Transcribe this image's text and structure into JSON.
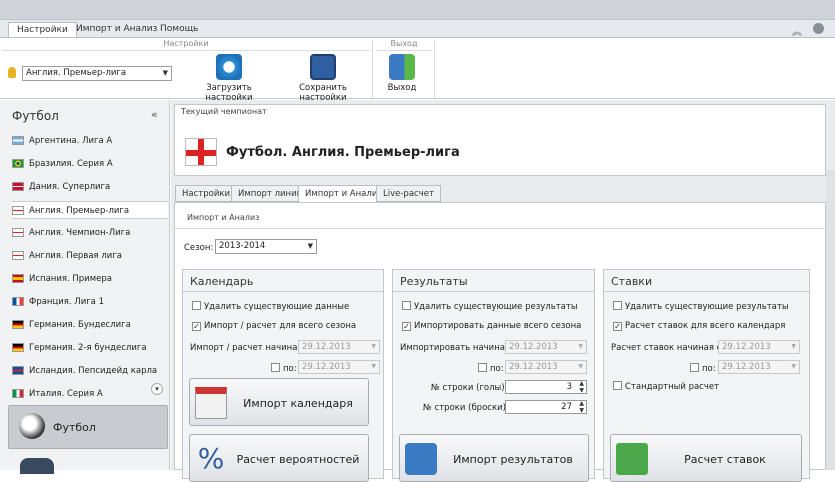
{
  "ribbon": {
    "tabs": [
      "Настройки",
      "Импорт и Анализ",
      "Помощь"
    ],
    "group_settings": "Настройки",
    "group_exit": "Выход",
    "league_combo": "Англия. Премьер-лига",
    "load_label": "Загрузить настройки",
    "save_label": "Сохранить настройки",
    "exit_label": "Выход"
  },
  "sidebar": {
    "title": "Футбол",
    "collapse": "«",
    "items": [
      {
        "label": "Аргентина. Лига А"
      },
      {
        "label": "Бразилия. Серия А"
      },
      {
        "label": "Дания. Суперлига"
      },
      {
        "label": "Англия. Премьер-лига"
      },
      {
        "label": "Англия. Чемпион-Лига"
      },
      {
        "label": "Англия. Первая лига"
      },
      {
        "label": "Испания. Примера"
      },
      {
        "label": "Франция. Лига 1"
      },
      {
        "label": "Германия. Бундеслига"
      },
      {
        "label": "Германия. 2-я бундеслига"
      },
      {
        "label": "Исландия. Пепсидейд карла"
      },
      {
        "label": "Италия. Серия А"
      }
    ],
    "big_button": "Футбол"
  },
  "champ": {
    "box_label": "Текущий чемпионат",
    "title": "Футбол. Англия. Премьер-лига"
  },
  "tabs": [
    "Настройки",
    "Импорт линий",
    "Импорт и Анализ",
    "Live-расчет"
  ],
  "content": {
    "box_label": "Импорт и Анализ",
    "season_label": "Сезон:",
    "season_value": "2013-2014"
  },
  "calendar": {
    "title": "Календарь",
    "delete_label": "Удалить существующие данные",
    "import_all_label": "Импорт / расчет для всего сезона",
    "from_label": "Импорт / расчет начиная с:",
    "from_date": "29.12.2013",
    "to_label": "по:",
    "to_date": "29.12.2013",
    "import_btn": "Импорт календаря",
    "calc_btn": "Расчет вероятностей"
  },
  "results": {
    "title": "Результаты",
    "delete_label": "Удалить существующие результаты",
    "import_all_label": "Импортировать данные всего сезона",
    "from_label": "Импортировать начиная с:",
    "from_date": "29.12.2013",
    "to_label": "по:",
    "to_date": "29.12.2013",
    "row_goals_label": "№ строки (голы):",
    "row_goals_value": "3",
    "row_shots_label": "№ строки (броски):",
    "row_shots_value": "27",
    "import_btn": "Импорт результатов"
  },
  "bets": {
    "title": "Ставки",
    "delete_label": "Удалить существующие результаты",
    "calc_all_label": "Расчет ставок для всего календаря",
    "from_label": "Расчет ставок начиная с:",
    "from_date": "29.12.2013",
    "to_label": "по:",
    "to_date": "29.12.2013",
    "standard_label": "Стандартный расчет",
    "calc_btn": "Расчет ставок"
  }
}
